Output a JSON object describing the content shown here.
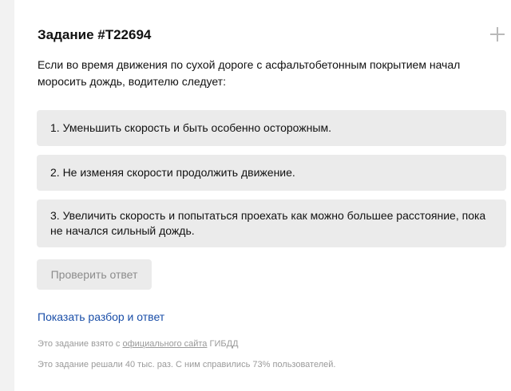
{
  "task": {
    "title": "Задание #Т22694",
    "question": "Если во время движения по сухой дороге с асфальтобетонным покрытием начал моросить дождь, водителю следует:",
    "answers": [
      "1. Уменьшить скорость и быть особенно осторожным.",
      "2. Не изменяя скорости продолжить движение.",
      "3. Увеличить скорость и попытаться проехать как можно большее расстояние, пока не начался сильный дождь."
    ],
    "check_button_label": "Проверить ответ",
    "show_answer_link": "Показать разбор и ответ"
  },
  "footer": {
    "source_prefix": "Это задание взято с",
    "source_link": "официального сайта",
    "source_suffix": "ГИБДД",
    "stats": "Это задание решали 40 тыс. раз. С ним справились 73% пользователей."
  },
  "icons": {
    "expand": "plus-icon"
  },
  "colors": {
    "link": "#1a4ea8",
    "answer_bg": "#ebebeb",
    "muted_text": "#9a9a9a"
  }
}
